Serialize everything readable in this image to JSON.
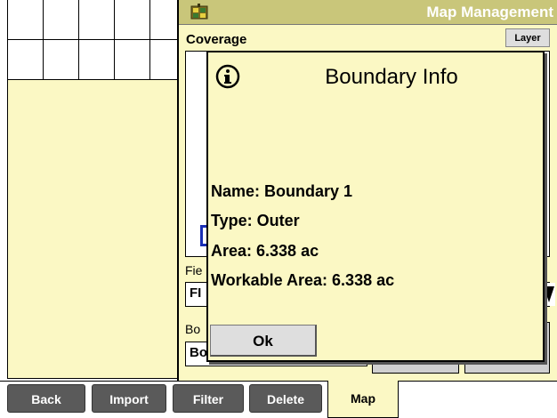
{
  "header": {
    "title": "Map Management"
  },
  "coverage": {
    "label": "Coverage",
    "layer_button": "Layer"
  },
  "fields": {
    "field_label": "Fie",
    "field_value": "FI",
    "boundary_label": "Bo",
    "boundary_value": "Bo"
  },
  "dialog": {
    "title": "Boundary Info",
    "icon": "info-icon",
    "name_line": "Name: Boundary 1",
    "type_line": "Type: Outer",
    "area_line": "Area: 6.338 ac",
    "workable_line": "Workable Area: 6.338 ac",
    "ok_label": "Ok"
  },
  "tabs": [
    {
      "label": "Back"
    },
    {
      "label": "Import"
    },
    {
      "label": "Filter"
    },
    {
      "label": "Delete"
    },
    {
      "label": "Map",
      "active": true
    }
  ],
  "colors": {
    "panel": "#fbf8c4",
    "titlebar": "#c9c67a",
    "tab": "#5a5a5a",
    "highlight_blue": "#1a2fb5"
  }
}
